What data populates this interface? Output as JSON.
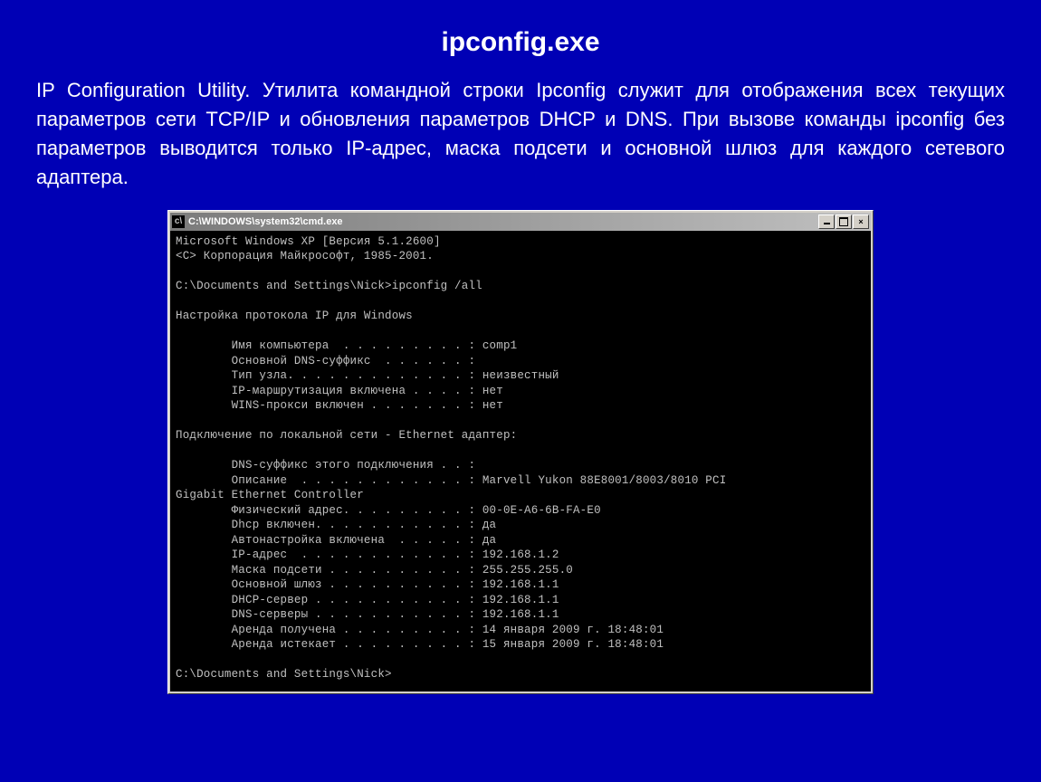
{
  "title": "ipconfig.exe",
  "description": "IP Configuration Utility. Утилита командной строки Ipconfig служит для отображения всех текущих параметров сети TCP/IP и обновления параметров DHCP и DNS. При вызове команды ipconfig без параметров выводится только IP-адрес, маска подсети и основной шлюз для каждого сетевого адаптера.",
  "cmd": {
    "titlebar_icon_label": "cmd-icon",
    "titlebar_text": "C:\\WINDOWS\\system32\\cmd.exe",
    "btn_close": "×",
    "output": "Microsoft Windows XP [Версия 5.1.2600]\n<C> Корпорация Майкрософт, 1985-2001.\n\nC:\\Documents and Settings\\Nick>ipconfig /all\n\nНастройка протокола IP для Windows\n\n        Имя компьютера  . . . . . . . . . : comp1\n        Основной DNS-суффикс  . . . . . . :\n        Тип узла. . . . . . . . . . . . . : неизвестный\n        IP-маршрутизация включена . . . . : нет\n        WINS-прокси включен . . . . . . . : нет\n\nПодключение по локальной сети - Ethernet адаптер:\n\n        DNS-суффикс этого подключения . . :\n        Описание  . . . . . . . . . . . . : Marvell Yukon 88E8001/8003/8010 PCI\nGigabit Ethernet Controller\n        Физический адрес. . . . . . . . . : 00-0E-A6-6B-FA-E0\n        Dhcp включен. . . . . . . . . . . : да\n        Автонастройка включена  . . . . . : да\n        IP-адрес  . . . . . . . . . . . . : 192.168.1.2\n        Маска подсети . . . . . . . . . . : 255.255.255.0\n        Основной шлюз . . . . . . . . . . : 192.168.1.1\n        DHCP-сервер . . . . . . . . . . . : 192.168.1.1\n        DNS-серверы . . . . . . . . . . . : 192.168.1.1\n        Аренда получена . . . . . . . . . : 14 января 2009 г. 18:48:01\n        Аренда истекает . . . . . . . . . : 15 января 2009 г. 18:48:01\n\nC:\\Documents and Settings\\Nick>"
  }
}
